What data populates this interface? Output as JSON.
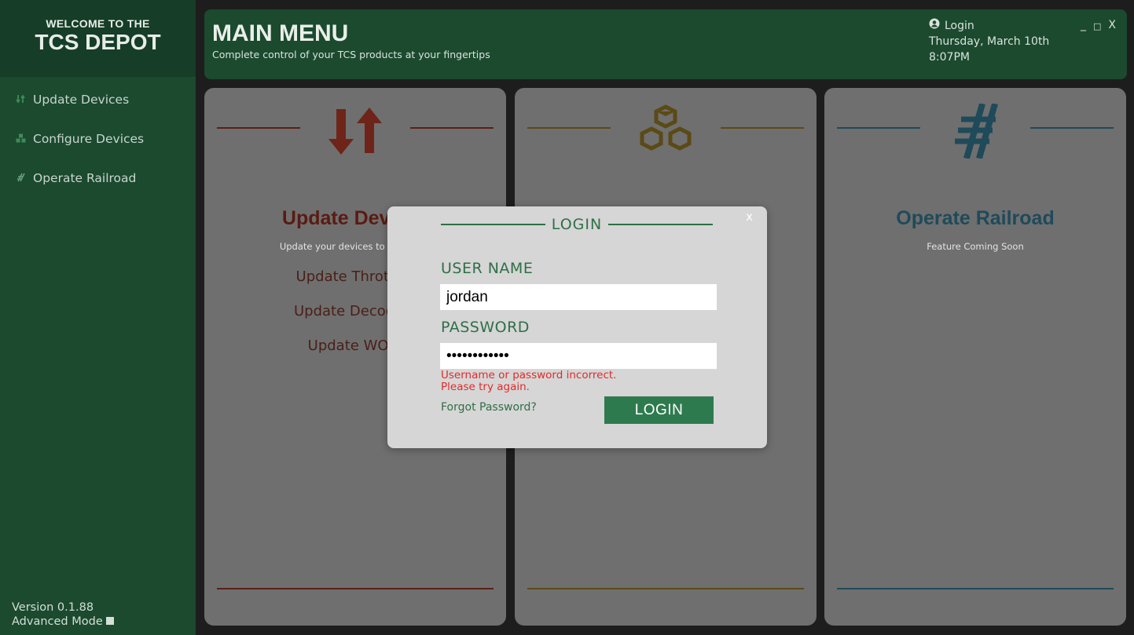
{
  "sidebar": {
    "brand_pre": "WELCOME TO THE",
    "brand_name": "TCS DEPOT",
    "items": [
      {
        "label": "Update Devices",
        "icon": "arrows-updown-icon"
      },
      {
        "label": "Configure Devices",
        "icon": "cubes-icon"
      },
      {
        "label": "Operate Railroad",
        "icon": "track-icon"
      }
    ],
    "version": "Version 0.1.88",
    "advanced_mode": "Advanced Mode"
  },
  "header": {
    "title": "MAIN MENU",
    "subtitle": "Complete control of your TCS products at your fingertips",
    "login": "Login",
    "date": "Thursday, March 10th",
    "time": "8:07PM",
    "win_min": "_",
    "win_max": "□",
    "win_close": "X"
  },
  "cards": {
    "update": {
      "title": "Update Devices",
      "desc": "Update your devices to the latest",
      "options": [
        "Update Throttles",
        "Update Decoders",
        "Update WOW"
      ],
      "color": "#6e2418"
    },
    "configure": {
      "color": "#5b4a16"
    },
    "operate": {
      "title": "Operate Railroad",
      "desc": "Feature Coming Soon",
      "color": "#1f4a5a"
    }
  },
  "login_modal": {
    "close": "x",
    "title": "LOGIN",
    "username_label": "USER NAME",
    "username_value": "jordan",
    "password_label": "PASSWORD",
    "password_value": "abcdefghijkl",
    "error_line1": "Username or password incorrect.",
    "error_line2": "Please try again.",
    "forgot": "Forgot Password?",
    "button": "LOGIN"
  },
  "colors": {
    "sidebar": "#1b4a2f",
    "accent": "#2e7a4f",
    "error": "#e22a2a"
  }
}
